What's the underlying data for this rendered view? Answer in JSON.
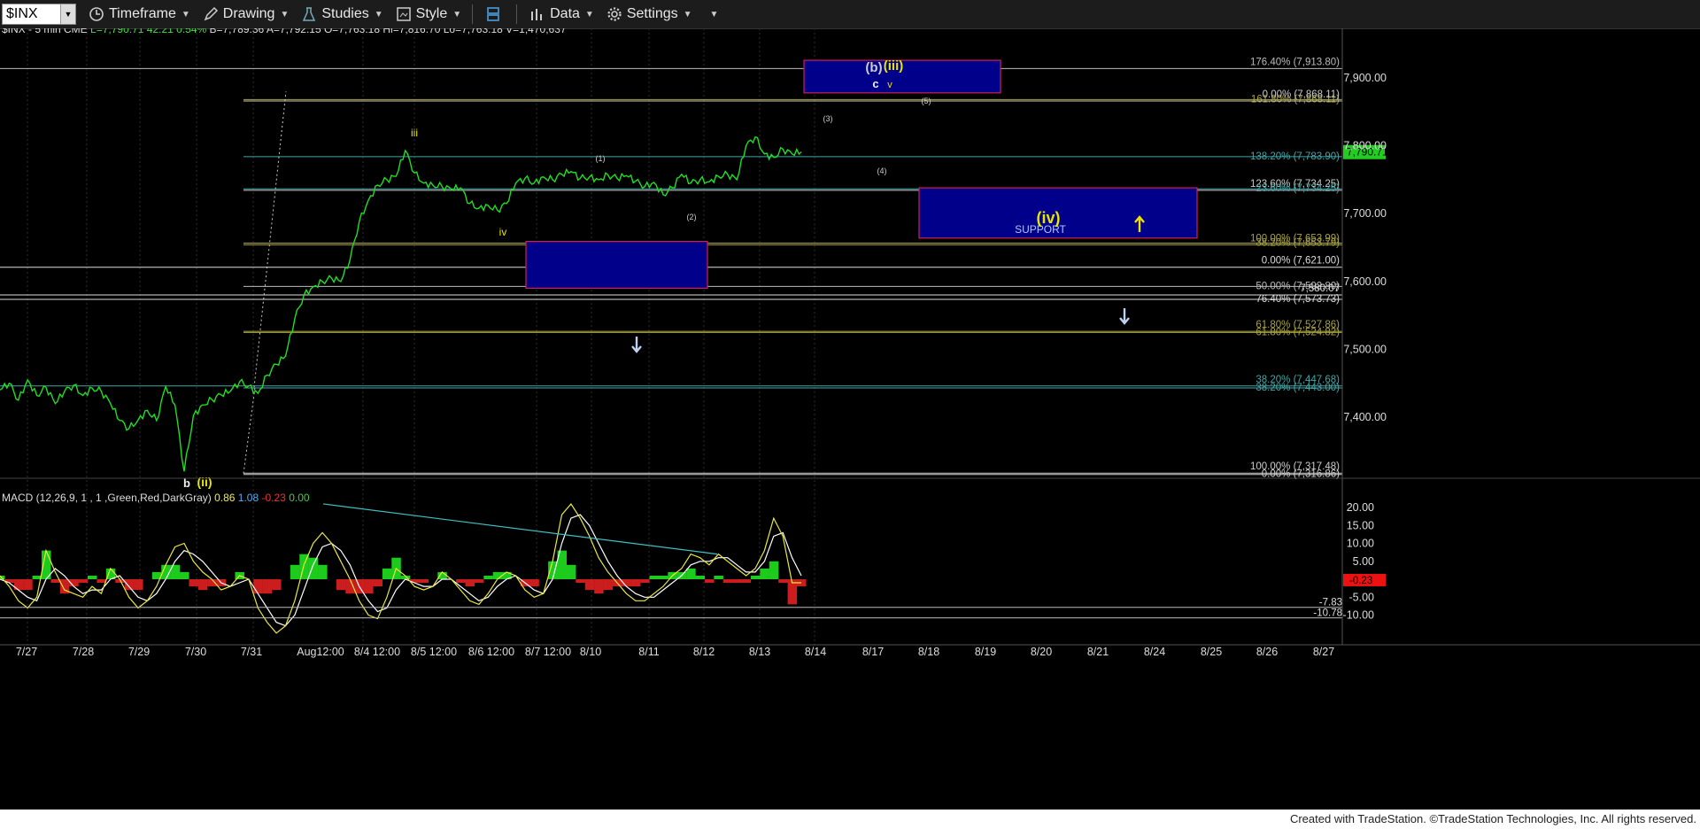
{
  "toolbar": {
    "symbol": "$INX",
    "items": [
      "Timeframe",
      "Drawing",
      "Studies",
      "Style",
      "Data",
      "Settings"
    ]
  },
  "header": {
    "title": "$INX - 5 min  CME",
    "values": [
      {
        "text": "L=7,790.71",
        "color": "#44dd44"
      },
      {
        "text": "42.21",
        "color": "#44dd44"
      },
      {
        "text": "0.54%",
        "color": "#44dd44"
      },
      {
        "text": "B=7,789.36",
        "color": "#dddddd"
      },
      {
        "text": "A=7,792.15",
        "color": "#dddddd"
      },
      {
        "text": "O=7,763.18",
        "color": "#dddddd"
      },
      {
        "text": "Hi=7,816.70",
        "color": "#dddddd"
      },
      {
        "text": "Lo=7,763.18",
        "color": "#dddddd"
      },
      {
        "text": "V=1,470,637",
        "color": "#dddddd"
      }
    ]
  },
  "macd_header": {
    "label": "MACD (12,26,9, 1 , 1 ,Green,Red,DarkGray)",
    "values": [
      {
        "text": "0.86",
        "color": "#eeee55"
      },
      {
        "text": "1.08",
        "color": "#55aaee"
      },
      {
        "text": "-0.23",
        "color": "#ee3333"
      },
      {
        "text": "0.00",
        "color": "#44cc44"
      }
    ]
  },
  "footer": "Created with TradeStation. ©TradeStation Technologies, Inc. All rights reserved.",
  "chart_data": [
    {
      "type": "line",
      "name": "price",
      "ylim": [
        7305,
        7985
      ],
      "yticks": [
        "7,900.00",
        "7,800.00",
        "7,700.00",
        "7,600.00",
        "7,500.00",
        "7,400.00"
      ],
      "ytick_values": [
        7900,
        7800,
        7700,
        7600,
        7500,
        7400
      ],
      "last_price": "7,790.71",
      "xticks": [
        "7/27",
        "7/28",
        "7/29",
        "7/30",
        "7/31",
        "Aug12:00",
        "8/4 12:00",
        "8/5 12:00",
        "8/6 12:00",
        "8/7 12:00",
        "8/10",
        "8/11",
        "8/12",
        "8/13",
        "8/14",
        "8/17",
        "8/18",
        "8/19",
        "8/20",
        "8/21",
        "8/24",
        "8/25",
        "8/26",
        "8/27"
      ],
      "price_points": [
        [
          0,
          7440
        ],
        [
          1,
          7450
        ],
        [
          2,
          7425
        ],
        [
          3,
          7455
        ],
        [
          4,
          7432
        ],
        [
          5,
          7444
        ],
        [
          6,
          7420
        ],
        [
          7,
          7438
        ],
        [
          8,
          7447
        ],
        [
          9,
          7432
        ],
        [
          10,
          7443
        ],
        [
          11,
          7438
        ],
        [
          12,
          7420
        ],
        [
          13,
          7395
        ],
        [
          14,
          7383
        ],
        [
          15,
          7396
        ],
        [
          16,
          7410
        ],
        [
          17,
          7395
        ],
        [
          18,
          7445
        ],
        [
          19,
          7418
        ],
        [
          20,
          7320
        ],
        [
          21,
          7402
        ],
        [
          22,
          7418
        ],
        [
          23,
          7426
        ],
        [
          24,
          7433
        ],
        [
          25,
          7438
        ],
        [
          26,
          7452
        ],
        [
          27,
          7446
        ],
        [
          28,
          7435
        ],
        [
          29,
          7462
        ],
        [
          30,
          7478
        ],
        [
          31,
          7490
        ],
        [
          32,
          7545
        ],
        [
          33,
          7580
        ],
        [
          34,
          7592
        ],
        [
          35,
          7600
        ],
        [
          36,
          7605
        ],
        [
          37,
          7600
        ],
        [
          38,
          7632
        ],
        [
          39,
          7688
        ],
        [
          40,
          7720
        ],
        [
          41,
          7742
        ],
        [
          42,
          7750
        ],
        [
          43,
          7755
        ],
        [
          44,
          7793
        ],
        [
          45,
          7760
        ],
        [
          46,
          7745
        ],
        [
          47,
          7742
        ],
        [
          48,
          7740
        ],
        [
          49,
          7736
        ],
        [
          50,
          7738
        ],
        [
          51,
          7715
        ],
        [
          52,
          7708
        ],
        [
          53,
          7712
        ],
        [
          54,
          7705
        ],
        [
          55,
          7715
        ],
        [
          56,
          7745
        ],
        [
          57,
          7752
        ],
        [
          58,
          7745
        ],
        [
          59,
          7754
        ],
        [
          60,
          7750
        ],
        [
          61,
          7758
        ],
        [
          62,
          7762
        ],
        [
          63,
          7752
        ],
        [
          64,
          7754
        ],
        [
          65,
          7750
        ],
        [
          66,
          7757
        ],
        [
          67,
          7752
        ],
        [
          68,
          7756
        ],
        [
          69,
          7748
        ],
        [
          70,
          7740
        ],
        [
          71,
          7746
        ],
        [
          72,
          7728
        ],
        [
          73,
          7738
        ],
        [
          74,
          7758
        ],
        [
          75,
          7745
        ],
        [
          76,
          7750
        ],
        [
          77,
          7747
        ],
        [
          78,
          7755
        ],
        [
          79,
          7758
        ],
        [
          80,
          7750
        ],
        [
          81,
          7800
        ],
        [
          82,
          7813
        ],
        [
          83,
          7788
        ],
        [
          84,
          7783
        ],
        [
          85,
          7795
        ],
        [
          86,
          7788
        ],
        [
          87,
          7791
        ]
      ],
      "fib_lines": [
        {
          "label": "176.40% (7,913.80)",
          "value": 7913.8,
          "color": "#bbbbbb"
        },
        {
          "label": "161.80% (7,868.11)",
          "value": 7868.1,
          "color": "#a9a33a"
        },
        {
          "label": "0.00% (7,868.11)",
          "value": 7866,
          "color": "#cccccc"
        },
        {
          "label": "138.20% (7,783.90)",
          "value": 7783.9,
          "color": "#3fa7a7"
        },
        {
          "label": "123.60% (7,734.25)",
          "value": 7734.3,
          "color": "#cccccc"
        },
        {
          "label": "23.60% (7,734.25)",
          "value": 7736.5,
          "color": "#3fa7a7"
        },
        {
          "label": "100.00% (7,653.99)",
          "value": 7654,
          "color": "#a9a33a"
        },
        {
          "label": "38.20% (7,653.79)",
          "value": 7656.5,
          "color": "#a9a33a"
        },
        {
          "label": "0.00% (7,621.00)",
          "value": 7621,
          "color": "#dddddd"
        },
        {
          "label": "50.00% (7,592.80)",
          "value": 7592.8,
          "color": "#bbbbbb"
        },
        {
          "label": "7,580.07",
          "value": 7580.1,
          "color": "#dddddd"
        },
        {
          "label": "76.40% (7,573.73)",
          "value": 7573.7,
          "color": "#dddddd"
        },
        {
          "label": "61.80% (7,527.86)",
          "value": 7526.5,
          "color": "#a9a33a"
        },
        {
          "label": "61.80% (7,524.82)",
          "value": 7524.8,
          "color": "#a9a33a"
        },
        {
          "label": "38.20% (7,447.68)",
          "value": 7446,
          "color": "#3fa7a7"
        },
        {
          "label": "38.20% (7,443.00)",
          "value": 7443,
          "color": "#3fa7a7"
        },
        {
          "label": "100.00% (7,317.48)",
          "value": 7317.5,
          "color": "#cccccc"
        },
        {
          "label": "0.00% (7,316.86)",
          "value": 7315.5,
          "color": "#cccccc"
        }
      ],
      "zones": [
        {
          "label": "",
          "top": 7926,
          "bottom": 7878
        },
        {
          "label": "",
          "top": 7659,
          "bottom": 7590
        },
        {
          "label": "SUPPORT",
          "top": 7738,
          "bottom": 7664
        }
      ],
      "wave_labels": [
        {
          "text": "(b)",
          "color": "#cccccc"
        },
        {
          "text": "(iii)",
          "color": "#e6e600"
        },
        {
          "text": "c",
          "color": "#eeeeee"
        },
        {
          "text": "v",
          "color": "#e6e600"
        },
        {
          "text": "(5)",
          "color": "#cccccc"
        },
        {
          "text": "(3)",
          "color": "#cccccc"
        },
        {
          "text": "(4)",
          "color": "#cccccc"
        },
        {
          "text": "(1)",
          "color": "#cccccc"
        },
        {
          "text": "(2)",
          "color": "#cccccc"
        },
        {
          "text": "iii",
          "color": "#e6e600"
        },
        {
          "text": "iv",
          "color": "#e6e600"
        },
        {
          "text": "(iv)",
          "color": "#e6e600"
        },
        {
          "text": "b",
          "color": "#eeeeee"
        },
        {
          "text": "(ii)",
          "color": "#e6e600"
        }
      ]
    },
    {
      "type": "line",
      "name": "macd",
      "ylim": [
        -16,
        23
      ],
      "yticks": [
        "20.00",
        "15.00",
        "10.00",
        "5.00",
        "0.00",
        "-5.00",
        "-10.00"
      ],
      "ytick_values": [
        20,
        15,
        10,
        5,
        0,
        -5,
        -10
      ],
      "special_values": [
        "-0.23",
        "-7.83",
        "-10.78"
      ],
      "macd": [
        1,
        -2,
        -6,
        -8,
        -5,
        8,
        2,
        -3,
        -4,
        -5,
        -2,
        -4,
        3,
        0,
        -5,
        -8,
        -6,
        -2,
        4,
        9,
        10,
        5,
        2,
        0,
        -3,
        -2,
        1,
        0,
        -8,
        -12,
        -15,
        -13,
        -6,
        4,
        10,
        13,
        10,
        5,
        0,
        -6,
        -10,
        -11,
        -5,
        3,
        1,
        -2,
        -3,
        -2,
        2,
        0,
        -3,
        -6,
        -7,
        -4,
        0,
        2,
        1,
        -3,
        -5,
        -4,
        5,
        18,
        21,
        17,
        12,
        6,
        2,
        -1,
        -4,
        -6,
        -6,
        -4,
        -2,
        1,
        3,
        7,
        6,
        4,
        7,
        5,
        3,
        1,
        3,
        8,
        17,
        12,
        -1,
        -1
      ],
      "signal": [
        0,
        -1,
        -3,
        -5,
        -6,
        0,
        3,
        1,
        -2,
        -4,
        -3,
        -3,
        0,
        1,
        -2,
        -5,
        -6,
        -4,
        0,
        5,
        8,
        7,
        5,
        2,
        -1,
        -2,
        -1,
        0,
        -4,
        -8,
        -12,
        -13,
        -10,
        -3,
        4,
        9,
        10,
        8,
        4,
        -2,
        -6,
        -9,
        -8,
        -3,
        0,
        -1,
        -2,
        -2,
        0,
        0,
        -2,
        -4,
        -6,
        -5,
        -2,
        0,
        1,
        -1,
        -3,
        -4,
        0,
        10,
        17,
        18,
        15,
        10,
        5,
        1,
        -2,
        -4,
        -5,
        -5,
        -3,
        -1,
        1,
        4,
        5,
        5,
        6,
        6,
        4,
        2,
        2,
        5,
        12,
        13,
        6,
        1
      ],
      "divergence_trendline": {
        "from": 21,
        "to": 7
      }
    }
  ]
}
